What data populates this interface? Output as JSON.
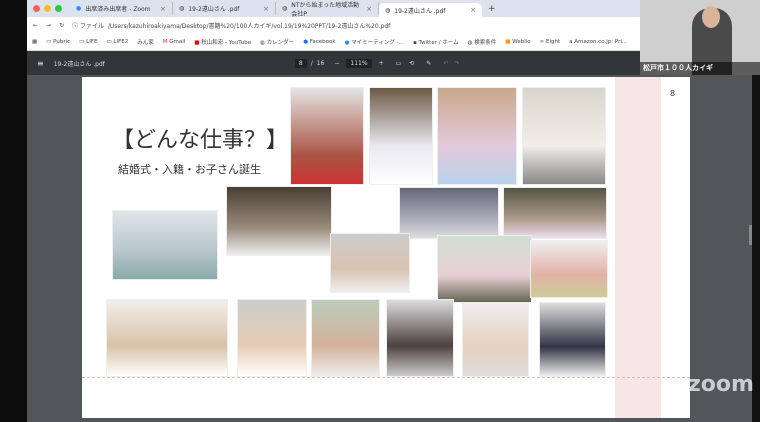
{
  "tabs": [
    {
      "label": "出席済み出席者 - Zoom"
    },
    {
      "label": "19-2遠山さん .pdf"
    },
    {
      "label": "NTから始まった地域活動会社P"
    },
    {
      "label": "19-2遠山さん .pdf",
      "active": true
    }
  ],
  "address": {
    "scheme": "ファイル",
    "url": "/Users/kazuhiroakiyama/Desktop/書籍%20/100人カイギ/vol.19/19%20PPT/19-2遠山さん%20.pdf"
  },
  "bookmarks": [
    "Pubric",
    "LIFE",
    "LIFE2",
    "みん家",
    "Gmail",
    "秋山和宏 - YouTube",
    "カレンダー",
    "Facebook",
    "マイミーティング -…",
    "Twitter / ホーム",
    "検索条件",
    "Weblio",
    "Eight",
    "Amazon.co.jp: Pri…"
  ],
  "pdf": {
    "filename": "19-2遠山さん .pdf",
    "page": "8",
    "total": "16",
    "zoom": "111%"
  },
  "slide": {
    "title": "【どんな仕事？】",
    "subtitle": "結婚式・入籍・お子さん誕生",
    "page_number": "8"
  },
  "webcam": {
    "caption": "松戸市１００人カイギ"
  },
  "watermark": "zoom",
  "colors": {
    "tabbar": "#dde3ee",
    "pdfbar": "#333639",
    "viewer": "#525659"
  }
}
